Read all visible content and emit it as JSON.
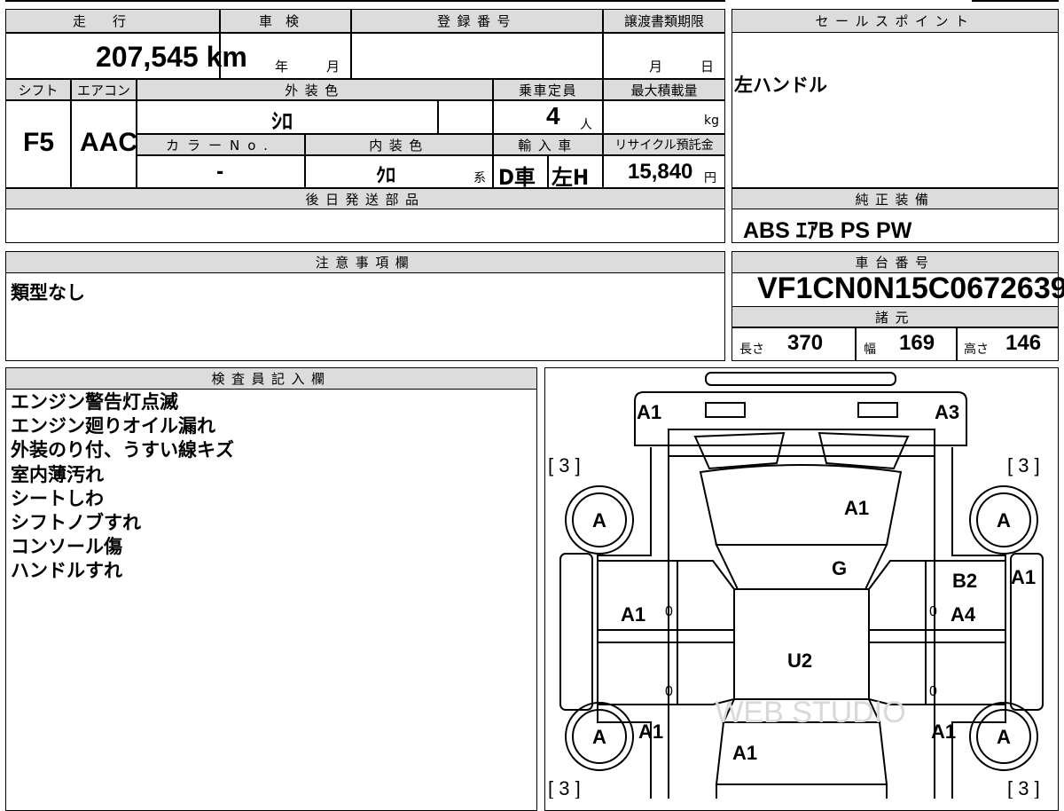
{
  "top_form": {
    "mileage_label": "走行",
    "mileage_value": "207,545 km",
    "inspection_label": "車検",
    "inspection_year": "年",
    "inspection_month": "月",
    "registration_label": "登録番号",
    "transfer_label": "譲渡書類期限",
    "transfer_month": "月",
    "transfer_day": "日",
    "shift_label": "シフト",
    "shift_value": "F5",
    "aircon_label": "エアコン",
    "aircon_value": "AAC",
    "exterior_label": "外装色",
    "exterior_value": "ｼﾛ",
    "capacity_label": "乗車定員",
    "capacity_value": "4",
    "capacity_unit": "人",
    "maxload_label": "最大積載量",
    "maxload_unit": "kg",
    "color_no_label": "カラーNo.",
    "color_no_value": "-",
    "interior_label": "内装色",
    "interior_value": "ｸﾛ",
    "interior_suffix": "系",
    "import_label": "輸入車",
    "import_value_1": "D車",
    "import_value_2": "左H",
    "recycle_label": "リサイクル預託金",
    "recycle_value": "15,840",
    "recycle_unit": "円",
    "later_parts_label": "後日発送部品",
    "later_parts_value": ""
  },
  "sales_point": {
    "label": "セールスポイント",
    "text": "左ハンドル"
  },
  "genuine_equipment": {
    "label": "純正装備",
    "text": "ABS ｴｱB PS PW"
  },
  "notes": {
    "label": "注意事項欄",
    "text": "類型なし"
  },
  "chassis": {
    "label": "車台番号",
    "value": "VF1CN0N15C0672639",
    "specs_label": "諸元",
    "length_label": "長さ",
    "length_value": "370",
    "width_label": "幅",
    "width_value": "169",
    "height_label": "高さ",
    "height_value": "146"
  },
  "inspector": {
    "label": "検査員記入欄",
    "lines": [
      "エンジン警告灯点滅",
      "エンジン廻りオイル漏れ",
      "外装のり付、うすい線キズ",
      "室内薄汚れ",
      "シートしわ",
      "シフトノブすれ",
      "コンソール傷",
      "ハンドルすれ"
    ]
  },
  "diagram": {
    "front_left": "A1",
    "front_right": "A3",
    "bracket_tl": "[ 3 ]",
    "bracket_tr": "[ 3 ]",
    "bracket_bl": "[ 3 ]",
    "bracket_br": "[ 3 ]",
    "wheel_fl": "A",
    "wheel_fr": "A",
    "wheel_rl": "A",
    "wheel_rr": "A",
    "hood": "A1",
    "windshield": "G",
    "roof": "U2",
    "left_front_door": "A1",
    "right_front_door_upper": "B2",
    "right_front_door_lower": "A4",
    "right_front_fender": "A1",
    "left_rear_quarter": "A1",
    "right_rear_quarter": "A1",
    "trunk": "A1",
    "zero_1": "0",
    "zero_2": "0",
    "zero_3": "0",
    "zero_4": "0",
    "watermark": "WEB STUDIO"
  }
}
